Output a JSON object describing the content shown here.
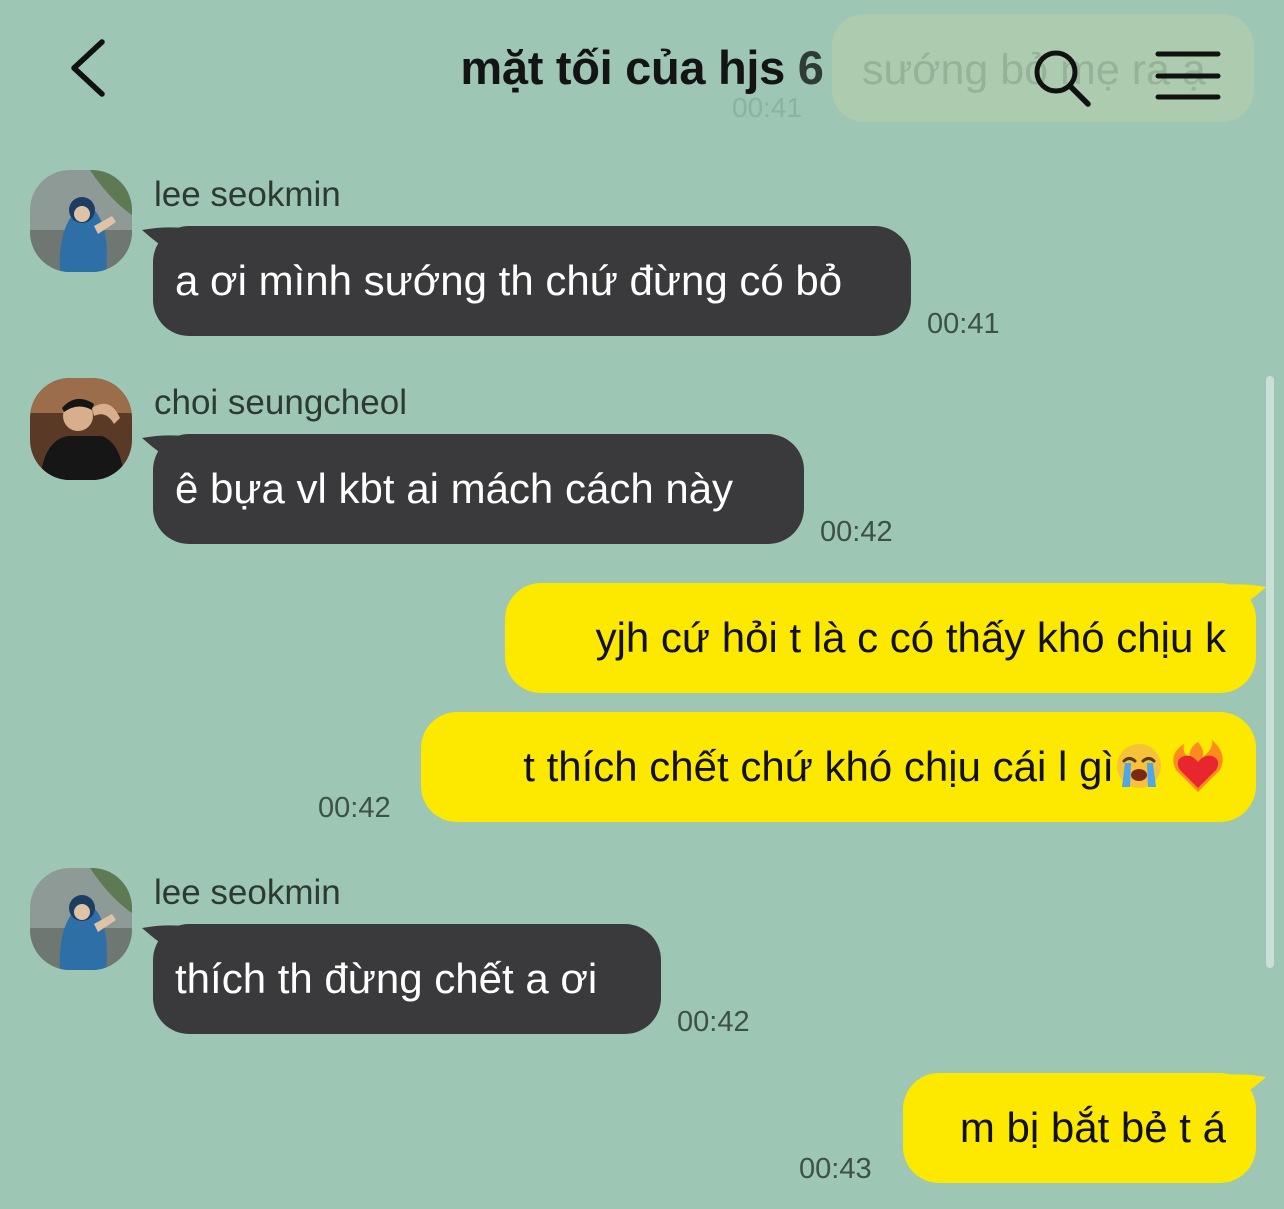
{
  "header": {
    "title": "mặt tối của hjs",
    "member_count": "6",
    "overlay_preview": {
      "text": "sướng bỏ mẹ ra ạ",
      "time": "00:41"
    }
  },
  "icons": {
    "back": "chevron-left-icon",
    "search": "search-icon",
    "menu": "hamburger-menu-icon"
  },
  "colors": {
    "background": "#9dc6b5",
    "incoming_bubble": "#3a3a3c",
    "outgoing_bubble": "#fde800"
  },
  "messages": [
    {
      "direction": "incoming",
      "sender": "lee seokmin",
      "text": "a ơi mình sướng th chứ đừng có bỏ",
      "time": "00:41"
    },
    {
      "direction": "incoming",
      "sender": "choi seungcheol",
      "text": "ê bựa vl kbt ai mách cách này",
      "time": "00:42"
    },
    {
      "direction": "outgoing",
      "text": "yjh cứ hỏi t là c có thấy khó chịu k"
    },
    {
      "direction": "outgoing",
      "text": "t thích chết chứ khó chịu cái l gì",
      "emojis": [
        "loudly-crying-face",
        "heart-on-fire"
      ],
      "time": "00:42"
    },
    {
      "direction": "incoming",
      "sender": "lee seokmin",
      "text": "thích th đừng chết a ơi",
      "time": "00:42"
    },
    {
      "direction": "outgoing",
      "text": "m bị bắt bẻ t á",
      "time": "00:43"
    }
  ]
}
